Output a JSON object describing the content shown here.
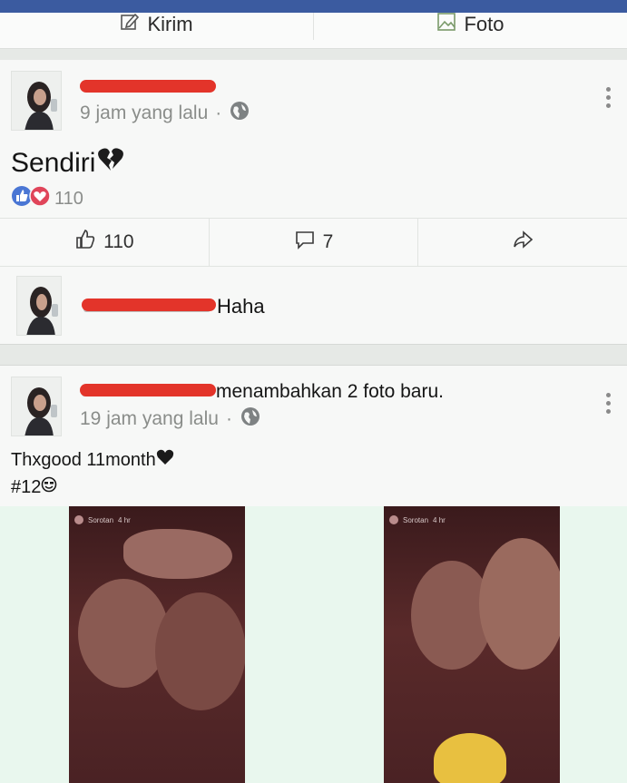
{
  "composer": {
    "send_label": "Kirim",
    "photo_label": "Foto"
  },
  "post1": {
    "time": "9 jam yang lalu",
    "text": "Sendiri",
    "reaction_count": "110",
    "like_count": "110",
    "comment_count": "7"
  },
  "comment": {
    "text": "Haha"
  },
  "post2": {
    "action": "menambahkan 2 foto baru.",
    "time": "19 jam yang lalu",
    "text_line1": "Thxgood 11month",
    "text_line2": "#12",
    "photos": [
      {
        "source": "Sorotan",
        "age": "4 hr"
      },
      {
        "source": "Sorotan",
        "age": "4 hr"
      }
    ]
  },
  "colors": {
    "header_blue": "#3b5ba0",
    "redaction": "#e3342a",
    "like_blue": "#4a76d4",
    "love_red": "#e0455a"
  },
  "icons": [
    "pencil-icon",
    "photo-icon",
    "globe-icon",
    "more-icon",
    "like-icon",
    "comment-icon",
    "share-icon",
    "broken-heart-icon",
    "heart-icon",
    "smile-icon"
  ]
}
